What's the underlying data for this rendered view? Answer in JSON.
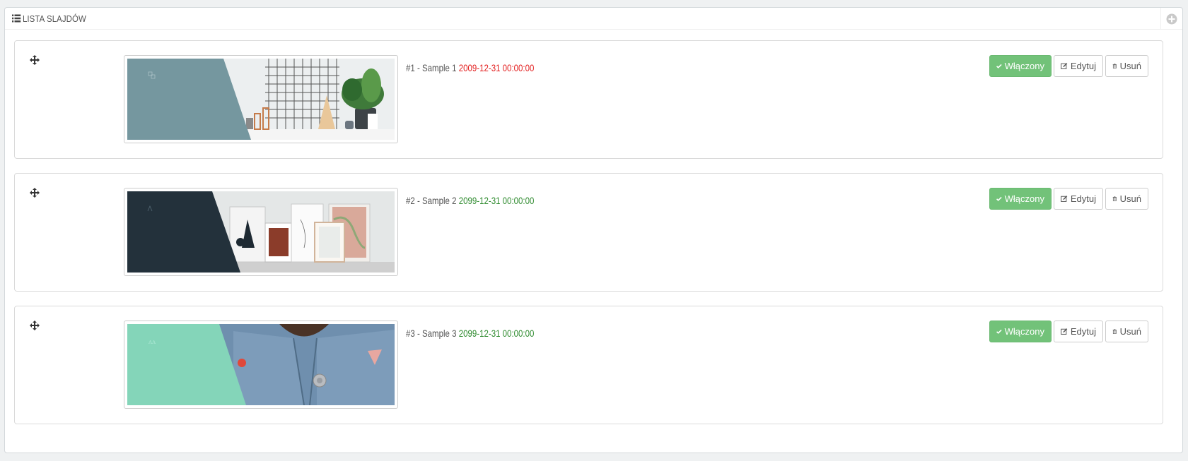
{
  "panel": {
    "title": "LISTA SLAJDÓW",
    "title_icon": "list-icon",
    "tool_icon": "add-circle-icon"
  },
  "colors": {
    "enabled_button": "#72c279",
    "date_expired": "#e31f1f",
    "date_active": "#2d8a2d"
  },
  "slides": [
    {
      "id_label": "#1 - Sample 1",
      "date": "2009-12-31 00:00:00",
      "date_status": "expired",
      "status_label": "Włączony",
      "edit_label": "Edytuj",
      "delete_label": "Usuń",
      "image_theme": "slate-blue with grid and potted plant"
    },
    {
      "id_label": "#2 - Sample 2",
      "date": "2099-12-31 00:00:00",
      "date_status": "active",
      "status_label": "Włączony",
      "edit_label": "Edytuj",
      "delete_label": "Usuń",
      "image_theme": "dark navy with framed prints"
    },
    {
      "id_label": "#3 - Sample 3",
      "date": "2099-12-31 00:00:00",
      "date_status": "active",
      "status_label": "Włączony",
      "edit_label": "Edytuj",
      "delete_label": "Usuń",
      "image_theme": "mint with denim jacket"
    }
  ]
}
